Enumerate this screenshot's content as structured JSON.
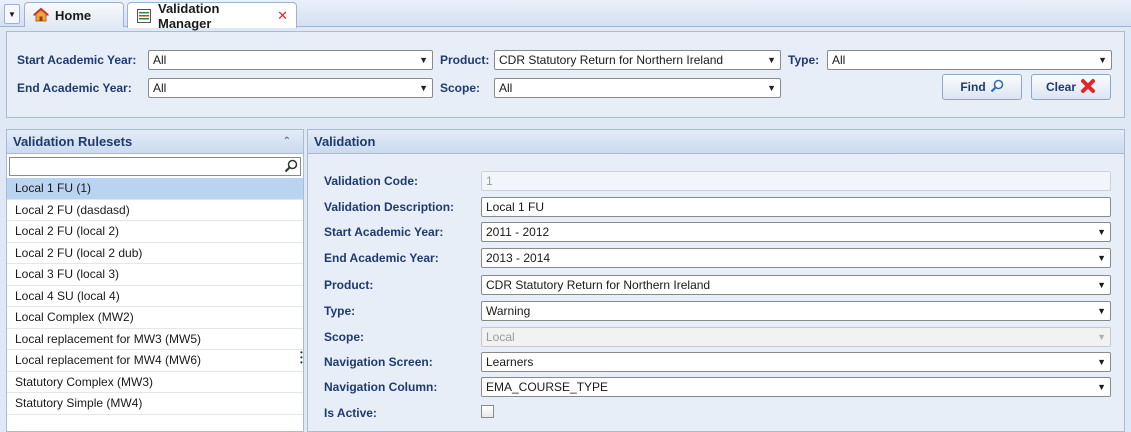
{
  "tabs": {
    "menu_glyph": "▼",
    "home": {
      "label": "Home",
      "icon": "home-icon"
    },
    "active": {
      "label": "Validation Manager",
      "icon": "validation-manager-icon",
      "close_glyph": "✕"
    }
  },
  "search": {
    "start_year": {
      "label": "Start Academic Year:",
      "value": "All"
    },
    "end_year": {
      "label": "End Academic Year:",
      "value": "All"
    },
    "product": {
      "label": "Product:",
      "value": "CDR Statutory Return for Northern Ireland"
    },
    "scope": {
      "label": "Scope:",
      "value": "All"
    },
    "type": {
      "label": "Type:",
      "value": "All"
    },
    "find_label": "Find",
    "clear_label": "Clear"
  },
  "rulesets": {
    "title": "Validation Rulesets",
    "filter_value": "",
    "items": [
      "Local 1 FU (1)",
      "Local 2 FU (dasdasd)",
      "Local 2 FU (local 2)",
      "Local 2 FU (local 2 dub)",
      "Local 3 FU (local 3)",
      "Local 4 SU (local 4)",
      "Local Complex (MW2)",
      "Local replacement for MW3 (MW5)",
      "Local replacement for MW4 (MW6)",
      "Statutory Complex (MW3)",
      "Statutory Simple (MW4)"
    ],
    "selected_index": 0
  },
  "validation": {
    "title": "Validation",
    "code": {
      "label": "Validation Code:",
      "value": "1"
    },
    "description": {
      "label": "Validation Description:",
      "value": "Local 1 FU"
    },
    "start_year": {
      "label": "Start Academic Year:",
      "value": "2011 - 2012"
    },
    "end_year": {
      "label": "End Academic Year:",
      "value": "2013 - 2014"
    },
    "product": {
      "label": "Product:",
      "value": "CDR Statutory Return for Northern Ireland"
    },
    "type": {
      "label": "Type:",
      "value": "Warning"
    },
    "scope": {
      "label": "Scope:",
      "value": "Local"
    },
    "nav_screen": {
      "label": "Navigation Screen:",
      "value": "Learners"
    },
    "nav_column": {
      "label": "Navigation Column:",
      "value": "EMA_COURSE_TYPE"
    },
    "is_active": {
      "label": "Is Active:",
      "checked": false
    }
  },
  "colors": {
    "accent": "#1e3b6e",
    "selection": "#b9d4f1",
    "close_red": "#e0262a"
  }
}
